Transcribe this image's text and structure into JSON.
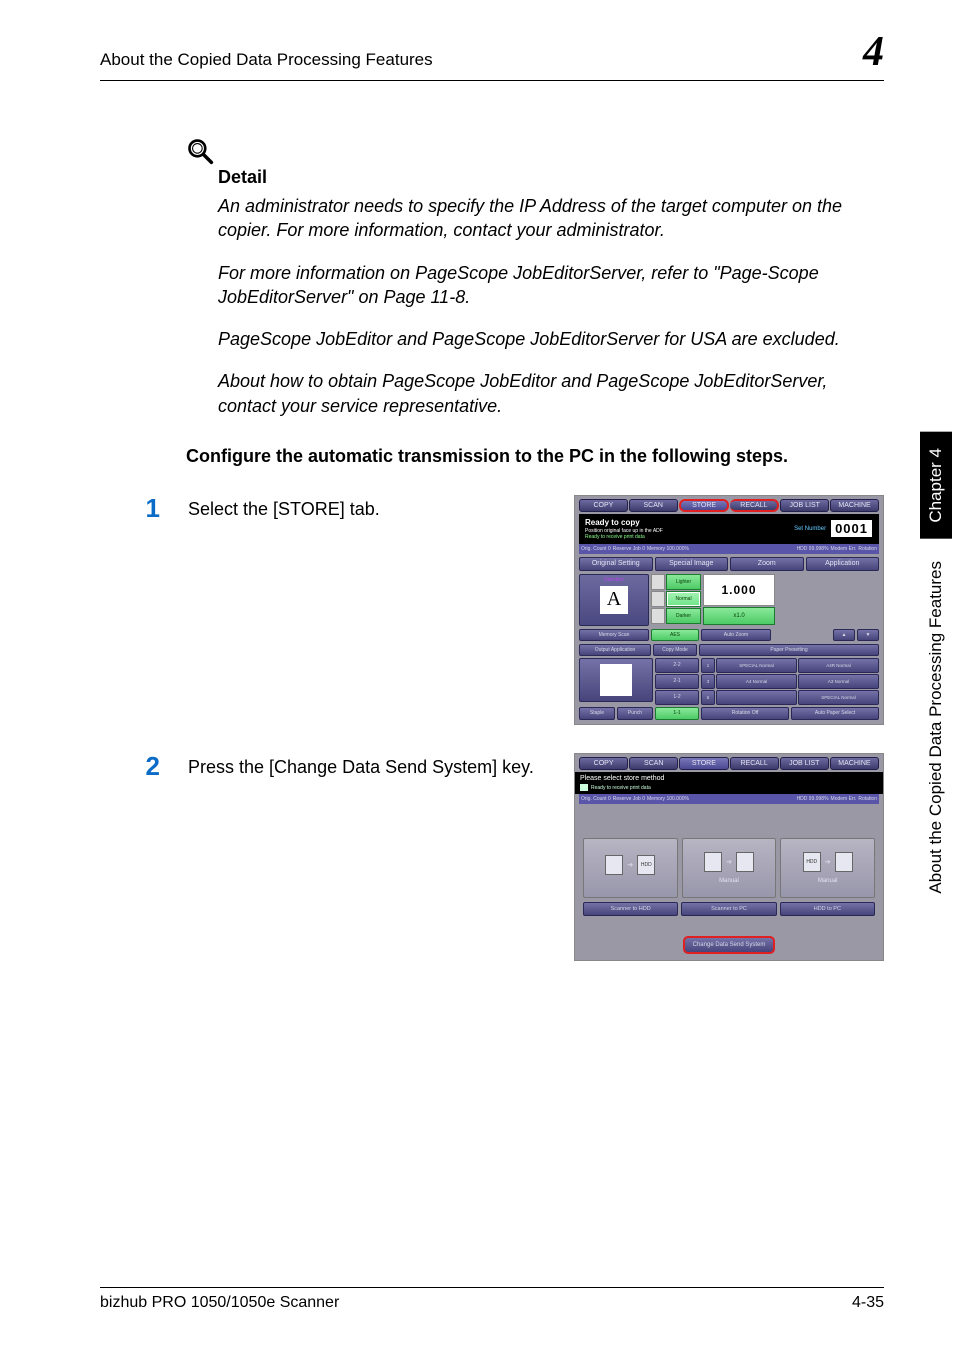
{
  "header": {
    "title": "About the Copied Data Processing Features",
    "chapter_num": "4"
  },
  "detail": {
    "heading": "Detail",
    "para1": "An administrator needs to specify the IP Address of the target computer on the copier. For more information, contact your administrator.",
    "para2": "For more information on PageScope JobEditorServer, refer to \"Page-Scope JobEditorServer\" on Page 11-8.",
    "para3": "PageScope JobEditor and PageScope JobEditorServer for USA are excluded.",
    "para4": "About how to obtain PageScope JobEditor and PageScope JobEditorServer, contact your service representative."
  },
  "config_heading": "Configure the automatic transmission to the PC in the following steps.",
  "steps": {
    "s1": {
      "num": "1",
      "text": "Select the [STORE] tab."
    },
    "s2": {
      "num": "2",
      "text": "Press the [Change Data Send System] key."
    }
  },
  "shot1": {
    "tabs": {
      "copy": "COPY",
      "scan": "SCAN",
      "store": "STORE",
      "recall": "RECALL",
      "joblist": "JOB LIST",
      "machine": "MACHINE"
    },
    "ready": "Ready to copy",
    "ready_sub1": "Position original face up in the ADF",
    "ready_sub2": "Ready to receive print data",
    "set_number_label": "Set Number",
    "set_number_value": "0001",
    "status": {
      "orig": "Orig. Count    0",
      "reserve": "Reserve Job    0",
      "memory": "Memory 100.000%",
      "hdd": "HDD     99.998%",
      "modem": "Modem Err.",
      "rotation": "Rotation"
    },
    "row_buttons": {
      "orig_set": "Original Setting",
      "special": "Special Image",
      "zoom": "Zoom",
      "application": "Application"
    },
    "direction_label": "Direction",
    "direction_a": "A",
    "density": {
      "lighter": "Lighter",
      "normal": "Normal",
      "darker": "Darker"
    },
    "zoom_value": "1.000",
    "zoom_x1": "x1.0",
    "row2": {
      "memory_scan": "Memory Scan",
      "aes": "AES",
      "auto_zoom": "Auto Zoom",
      "up": "▲",
      "down": "▼"
    },
    "row3": {
      "output_app": "Output Application",
      "copy_mode": "Copy Mode",
      "paper_preset": "Paper Presetting"
    },
    "copy_modes": {
      "c22": "2-2",
      "c21": "2-1",
      "c12": "1-2",
      "c11": "1-1"
    },
    "trays": {
      "t1": "SPECIAL Normal",
      "t2": "A4R Normal",
      "t3": "A4 Normal",
      "t4": "A3 Normal",
      "t5": "SPECIAL Normal"
    },
    "bottom": {
      "staple": "Staple",
      "punch": "Punch",
      "rotation_off": "Rotation Off",
      "auto_paper": "Auto Paper Select"
    }
  },
  "shot2": {
    "tabs": {
      "copy": "COPY",
      "scan": "SCAN",
      "store": "STORE",
      "recall": "RECALL",
      "joblist": "JOB LIST",
      "machine": "MACHINE"
    },
    "msg": "Please select store method",
    "sub": "Ready to receive print data",
    "status": {
      "orig": "Orig. Count    0",
      "reserve": "Reserve Job    0",
      "memory": "Memory 100.000%",
      "hdd": "HDD     99.998%",
      "modem": "Modem Err.",
      "rotation": "Rotation"
    },
    "cards": {
      "c1": {
        "from": "scanner",
        "to": "HDD",
        "label": ""
      },
      "c2": {
        "from": "scanner",
        "to": "PC",
        "label": "Manual"
      },
      "c3": {
        "from": "HDD",
        "to": "PC",
        "label": "Manual"
      }
    },
    "tabs2": {
      "a": "Scanner to HDD",
      "b": "Scanner to PC",
      "c": "HDD to PC"
    },
    "change_btn": "Change Data Send System"
  },
  "sidebar": {
    "chapter": "Chapter 4",
    "features": "About the Copied Data Processing Features"
  },
  "footer": {
    "left": "bizhub PRO 1050/1050e Scanner",
    "right": "4-35"
  }
}
